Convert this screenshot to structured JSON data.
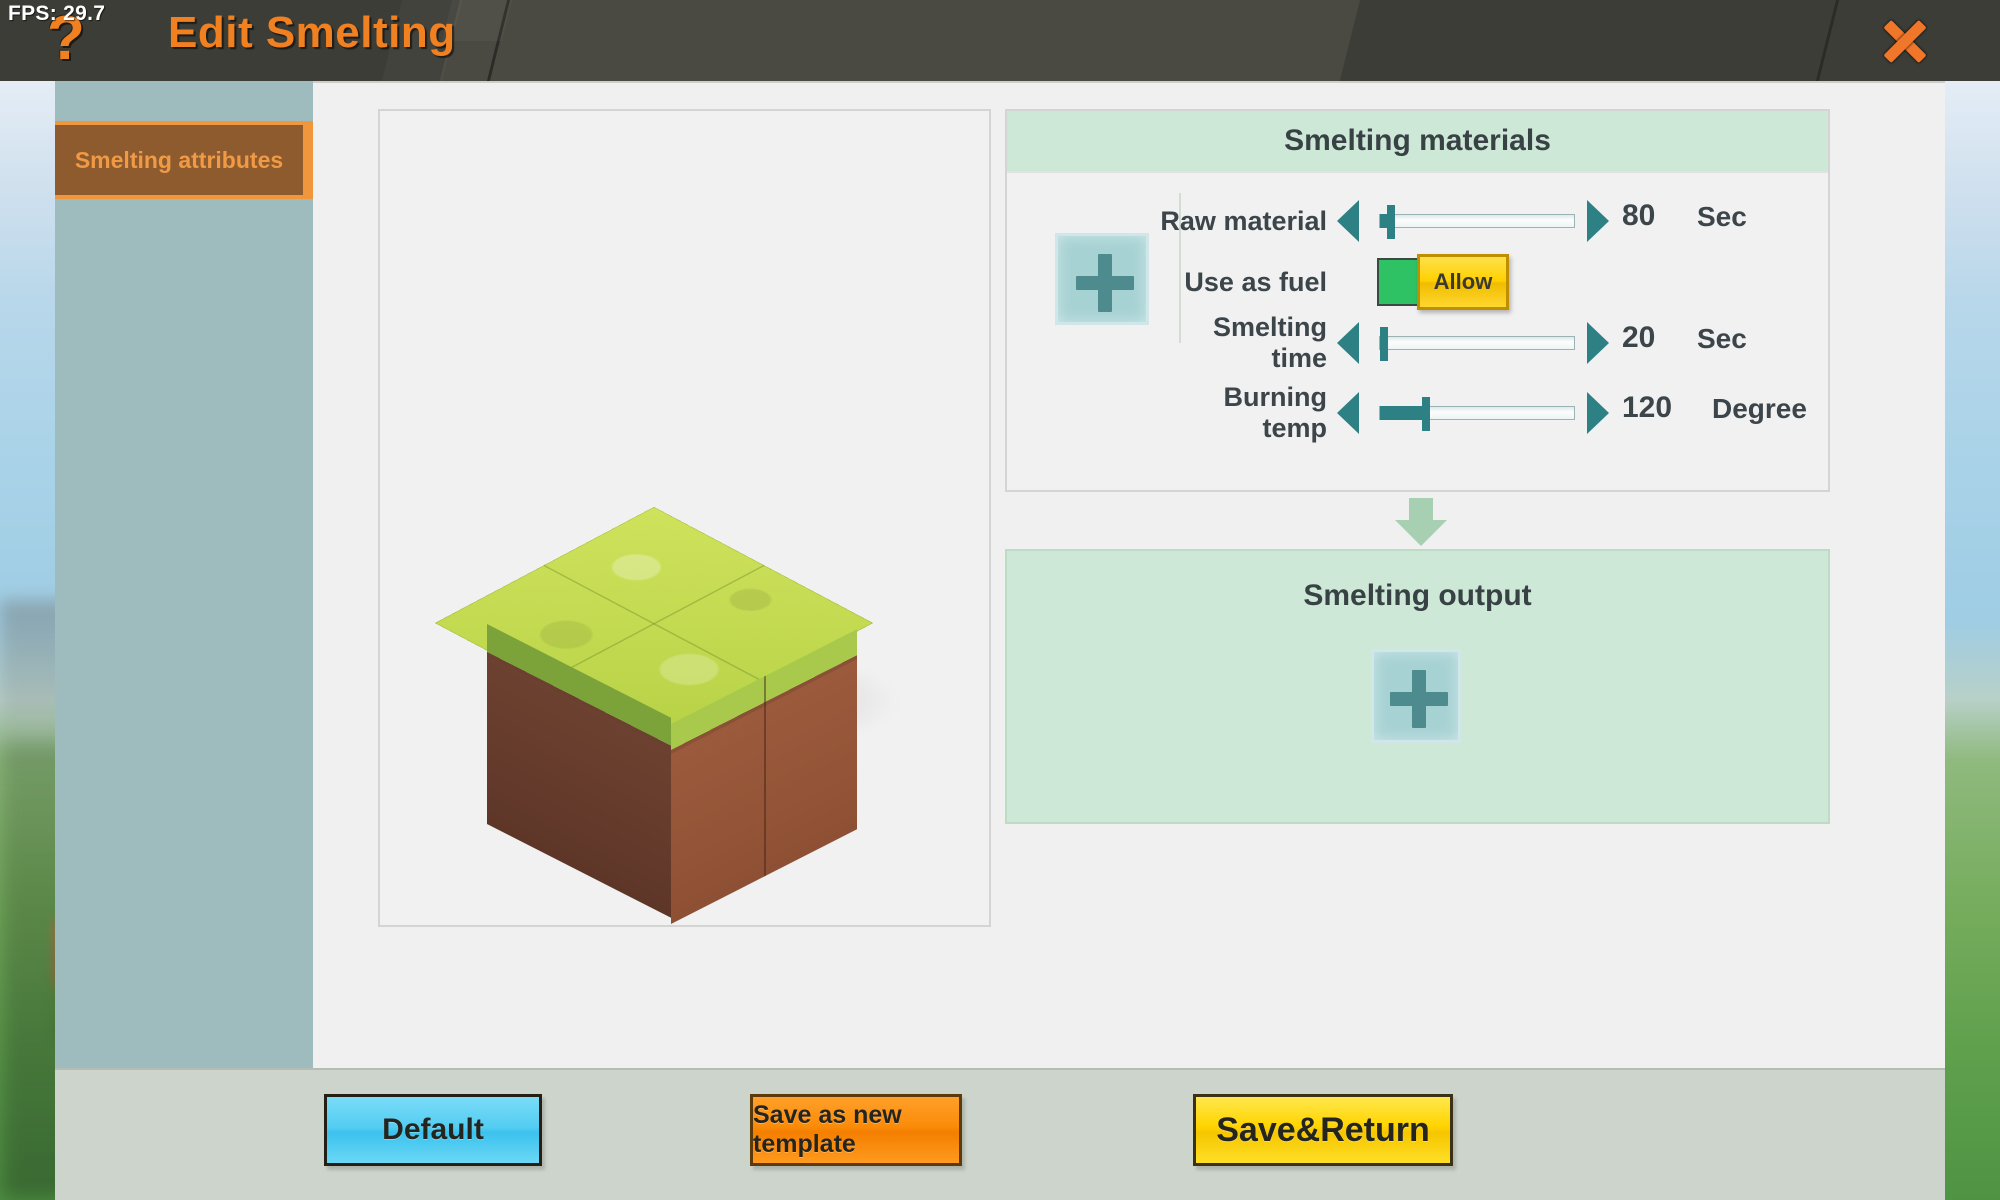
{
  "titlebar": {
    "fps": "FPS: 29.7",
    "help_icon": "?",
    "title": "Edit Smelting",
    "close_icon": "close-icon"
  },
  "sidebar": {
    "tabs": [
      {
        "label": "Smelting attributes",
        "active": true
      }
    ]
  },
  "preview": {
    "block_name": "grass-block"
  },
  "materials": {
    "title": "Smelting materials",
    "add_slot_icon": "+",
    "rows": [
      {
        "label": "Raw material",
        "value": "80",
        "unit": "Sec",
        "fill_percent": 4,
        "thumb_percent": 4,
        "left_arrow": "decrease",
        "right_arrow": "increase"
      },
      {
        "label": "Smelting time",
        "value": "20",
        "unit": "Sec",
        "fill_percent": 0,
        "thumb_percent": 0,
        "left_arrow": "decrease",
        "right_arrow": "increase"
      },
      {
        "label": "Burning temp",
        "value": "120",
        "unit": "Degree",
        "fill_percent": 23,
        "thumb_percent": 23,
        "left_arrow": "decrease",
        "right_arrow": "increase"
      }
    ],
    "fuel": {
      "label": "Use as fuel",
      "state_label": "Allow",
      "on_color": "#2ec264",
      "knob_color": "#ffd000"
    }
  },
  "output": {
    "title": "Smelting output",
    "add_slot_icon": "+"
  },
  "footer": {
    "buttons": [
      {
        "label": "Default",
        "color": "#53cdf2"
      },
      {
        "label": "Save as new template",
        "color": "#fb8c0a"
      },
      {
        "label": "Save&Return",
        "color": "#ffd400"
      }
    ]
  },
  "theme": {
    "accent_orange": "#f08020",
    "panel_green": "#cee8d7",
    "slider_teal": "#2d8184",
    "sidebar_blue": "#9ebcbe"
  }
}
